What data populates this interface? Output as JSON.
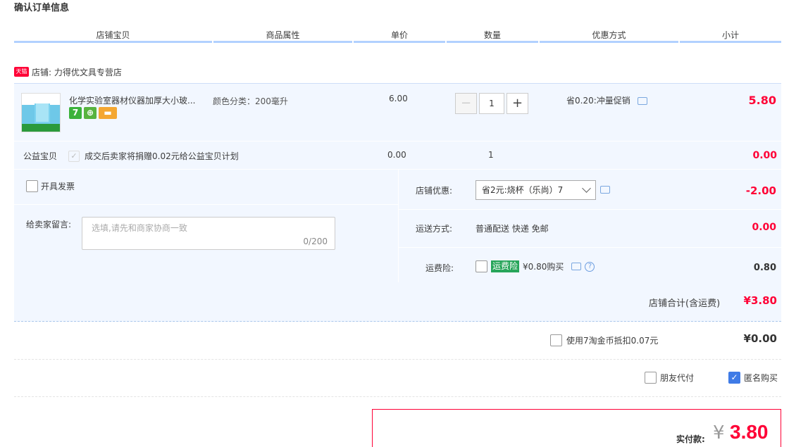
{
  "page_title": "确认订单信息",
  "columns": [
    "店铺宝贝",
    "商品属性",
    "单价",
    "数量",
    "优惠方式",
    "小计"
  ],
  "shop": {
    "badge": "天猫",
    "label": "店铺: 力得优文具专营店"
  },
  "item": {
    "name": "化学实验室器材仪器加厚大小玻...",
    "badges": [
      "7",
      "",
      ""
    ],
    "attr": "颜色分类：200毫升",
    "price": "6.00",
    "qty": "1",
    "qty_minus": "−",
    "qty_plus": "+",
    "promo": "省0.20:冲量促销",
    "subtotal": "5.80"
  },
  "charity": {
    "label": "公益宝贝",
    "check": "✓",
    "text": "成交后卖家将捐赠0.02元给公益宝贝计划",
    "price": "0.00",
    "qty": "1",
    "subtotal": "0.00"
  },
  "invoice_label": "开具发票",
  "message": {
    "label": "给卖家留言:",
    "placeholder": "选填,请先和商家协商一致",
    "count": "0/200"
  },
  "shop_discount": {
    "label": "店铺优惠:",
    "value": "省2元:烧杯（乐尚）7",
    "amount": "-2.00"
  },
  "shipping": {
    "label": "运送方式:",
    "value": "普通配送 快递 免邮",
    "amount": "0.00"
  },
  "insurance": {
    "label": "运费险:",
    "tag": "运费险",
    "text": "¥0.80购买",
    "help": "?",
    "amount": "0.80"
  },
  "shop_total": {
    "label": "店铺合计(含运费)",
    "value": "¥3.80"
  },
  "taojinbi": {
    "text": "使用7淘金币抵扣0.07元",
    "amount": "¥0.00"
  },
  "friend_pay": "朋友代付",
  "anonymous": {
    "label": "匿名购买",
    "check": "✓"
  },
  "pay": {
    "label": "实付款:",
    "yen": "¥",
    "value": "3.80"
  },
  "colors": {
    "accent_red": "#ff0036",
    "header_line": "#b2d1ff",
    "panel_bg": "#f2f7ff"
  }
}
